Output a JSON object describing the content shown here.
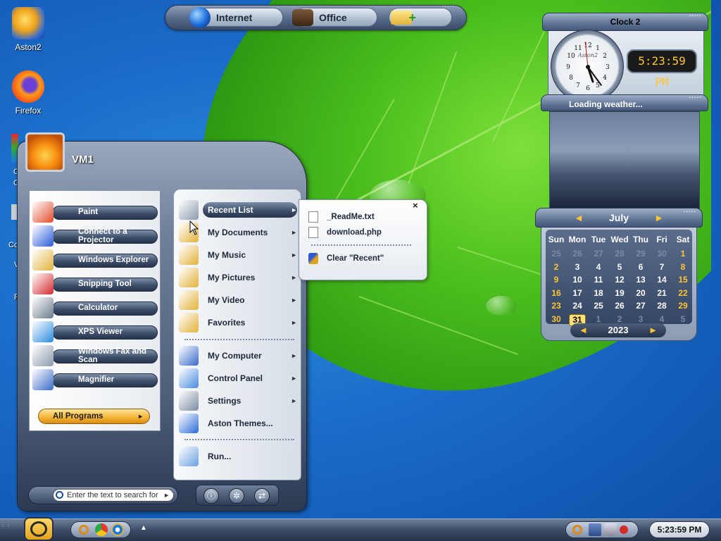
{
  "desktop": {
    "icons": [
      {
        "label": "Aston2",
        "icon": "aston2-icon"
      },
      {
        "label": "Firefox",
        "icon": "firefox-icon"
      }
    ],
    "partial_labels": [
      "C",
      "C",
      "Co",
      "V",
      "R"
    ]
  },
  "topbar": {
    "buttons": [
      {
        "label": "Internet",
        "icon": "globe-icon"
      },
      {
        "label": "Office",
        "icon": "briefcase-icon"
      },
      {
        "label": "",
        "icon": "add-folder-icon"
      }
    ]
  },
  "clock": {
    "title": "Clock 2",
    "dial_brand": "Aston2",
    "digital_time": "5:23:59 PM",
    "hour": 5,
    "minute": 23,
    "second": 59
  },
  "weather": {
    "status": "Loading weather..."
  },
  "calendar": {
    "month": "July",
    "year": "2023",
    "weekdays": [
      "Sun",
      "Mon",
      "Tue",
      "Wed",
      "Thu",
      "Fri",
      "Sat"
    ],
    "weeks": [
      [
        "25",
        "26",
        "27",
        "28",
        "29",
        "30",
        "1"
      ],
      [
        "2",
        "3",
        "4",
        "5",
        "6",
        "7",
        "8"
      ],
      [
        "9",
        "10",
        "11",
        "12",
        "13",
        "14",
        "15"
      ],
      [
        "16",
        "17",
        "18",
        "19",
        "20",
        "21",
        "22"
      ],
      [
        "23",
        "24",
        "25",
        "26",
        "27",
        "28",
        "29"
      ],
      [
        "30",
        "31",
        "1",
        "2",
        "3",
        "4",
        "5"
      ]
    ],
    "today": "31",
    "accent": "#ffc531"
  },
  "start_menu": {
    "user": "VM1",
    "left_items": [
      {
        "label": "Paint",
        "icon": "paint-icon"
      },
      {
        "label": "Connect to a Projector",
        "icon": "projector-icon"
      },
      {
        "label": "Windows Explorer",
        "icon": "explorer-icon"
      },
      {
        "label": "Snipping Tool",
        "icon": "scissors-icon"
      },
      {
        "label": "Calculator",
        "icon": "calculator-icon"
      },
      {
        "label": "XPS Viewer",
        "icon": "xps-icon"
      },
      {
        "label": "Windows Fax and Scan",
        "icon": "fax-icon"
      },
      {
        "label": "Magnifier",
        "icon": "magnifier-icon"
      }
    ],
    "all_programs": "All Programs",
    "right_items": [
      {
        "label": "Recent List",
        "icon": "recent-icon",
        "arrow": "►"
      },
      {
        "label": "My Documents",
        "icon": "documents-folder-icon",
        "arrow": "►"
      },
      {
        "label": "My Music",
        "icon": "music-folder-icon",
        "arrow": "►"
      },
      {
        "label": "My Pictures",
        "icon": "pictures-folder-icon",
        "arrow": "►"
      },
      {
        "label": "My Video",
        "icon": "video-folder-icon",
        "arrow": "►"
      },
      {
        "label": "Favorites",
        "icon": "favorites-folder-icon",
        "arrow": "►"
      },
      {
        "label": "My Computer",
        "icon": "computer-icon",
        "arrow": "►"
      },
      {
        "label": "Control Panel",
        "icon": "control-panel-icon",
        "arrow": "►"
      },
      {
        "label": "Settings",
        "icon": "settings-icon",
        "arrow": "►"
      },
      {
        "label": "Aston Themes...",
        "icon": "aston-themes-icon",
        "arrow": ""
      },
      {
        "label": "Run...",
        "icon": "run-icon",
        "arrow": ""
      }
    ],
    "search_placeholder": "Enter the text to search for"
  },
  "recent_popup": {
    "items": [
      "_ReadMe.txt",
      "download.php"
    ],
    "clear": "Clear \"Recent\"",
    "close": "×"
  },
  "taskbar": {
    "clock": "5:23:59 PM",
    "tray_icons": [
      "search-icon",
      "network-icon",
      "volume-icon",
      "notification-icon"
    ],
    "quicklaunch": [
      "search-icon",
      "chrome-icon",
      "ie-icon"
    ]
  }
}
